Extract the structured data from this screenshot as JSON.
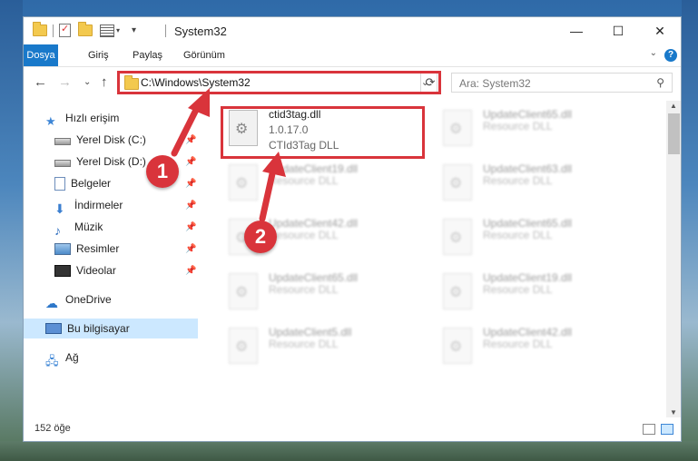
{
  "window": {
    "title": "System32",
    "minimize": "—",
    "maximize": "☐",
    "close": "✕"
  },
  "ribbon": {
    "tabs": [
      "Dosya",
      "Giriş",
      "Paylaş",
      "Görünüm"
    ],
    "help": "?"
  },
  "address": {
    "path": "C:\\Windows\\System32",
    "search_placeholder": "Ara: System32"
  },
  "sidebar": {
    "quick_access": "Hızlı erişim",
    "items": [
      "Yerel Disk (C:)",
      "Yerel Disk (D:)",
      "Belgeler",
      "İndirmeler",
      "Müzik",
      "Resimler",
      "Videolar"
    ],
    "onedrive": "OneDrive",
    "this_pc": "Bu bilgisayar",
    "network": "Ağ"
  },
  "selected_file": {
    "name": "ctid3tag.dll",
    "version": "1.0.17.0",
    "description": "CTId3Tag DLL"
  },
  "background_files": [
    {
      "name": "UpdateClient65.dll",
      "desc": "Resource DLL"
    },
    {
      "name": "UpdateClient19.dll",
      "desc": "Resource DLL"
    },
    {
      "name": "UpdateClient63.dll",
      "desc": "Resource DLL"
    },
    {
      "name": "UpdateClient42.dll",
      "desc": "Resource DLL"
    },
    {
      "name": "UpdateClient65.dll",
      "desc": "Resource DLL"
    },
    {
      "name": "UpdateClient65.dll",
      "desc": "Resource DLL"
    },
    {
      "name": "UpdateClient19.dll",
      "desc": "Resource DLL"
    },
    {
      "name": "UpdateClient5.dll",
      "desc": "Resource DLL"
    },
    {
      "name": "UpdateClient42.dll",
      "desc": "Resource DLL"
    }
  ],
  "status": {
    "item_count": "152 öğe"
  },
  "callouts": {
    "one": "1",
    "two": "2"
  },
  "colors": {
    "accent": "#1979ca",
    "highlight": "#d9343b",
    "selected_nav": "#cce8ff"
  }
}
